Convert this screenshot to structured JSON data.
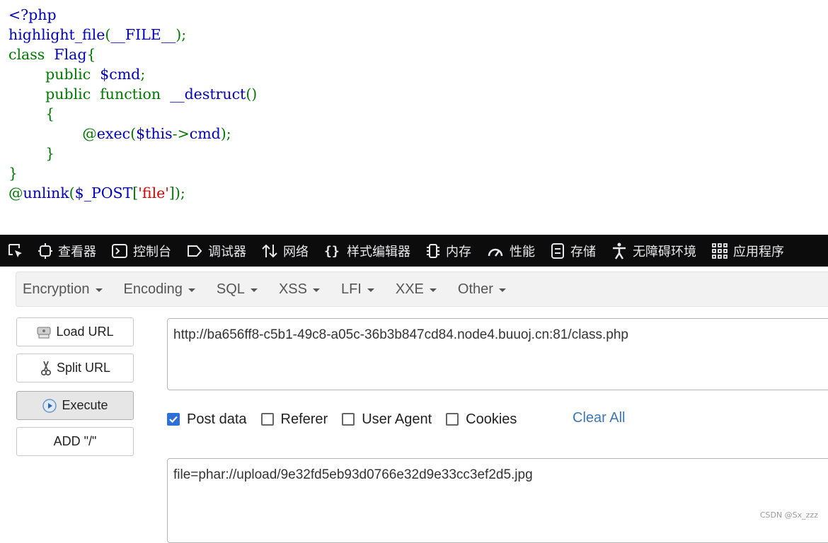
{
  "code": {
    "lines": [
      [
        {
          "t": "<?php",
          "c": "default"
        }
      ],
      [
        {
          "t": "highlight_file",
          "c": "default"
        },
        {
          "t": "(",
          "c": "keyword"
        },
        {
          "t": "__FILE__",
          "c": "default"
        },
        {
          "t": ");",
          "c": "keyword"
        }
      ],
      [
        {
          "t": "class  ",
          "c": "keyword"
        },
        {
          "t": "Flag",
          "c": "default"
        },
        {
          "t": "{",
          "c": "keyword"
        }
      ],
      [
        {
          "t": "        public  ",
          "c": "keyword"
        },
        {
          "t": "$cmd",
          "c": "default"
        },
        {
          "t": ";",
          "c": "keyword"
        }
      ],
      [
        {
          "t": "        public  function  ",
          "c": "keyword"
        },
        {
          "t": "__destruct",
          "c": "default"
        },
        {
          "t": "()",
          "c": "keyword"
        }
      ],
      [
        {
          "t": "        {",
          "c": "keyword"
        }
      ],
      [
        {
          "t": "                @",
          "c": "keyword"
        },
        {
          "t": "exec",
          "c": "default"
        },
        {
          "t": "(",
          "c": "keyword"
        },
        {
          "t": "$this",
          "c": "default"
        },
        {
          "t": "->",
          "c": "keyword"
        },
        {
          "t": "cmd",
          "c": "default"
        },
        {
          "t": ");",
          "c": "keyword"
        }
      ],
      [
        {
          "t": "        }",
          "c": "keyword"
        }
      ],
      [
        {
          "t": "}",
          "c": "keyword"
        }
      ],
      [
        {
          "t": "@",
          "c": "keyword"
        },
        {
          "t": "unlink",
          "c": "default"
        },
        {
          "t": "(",
          "c": "keyword"
        },
        {
          "t": "$_POST",
          "c": "default"
        },
        {
          "t": "[",
          "c": "keyword"
        },
        {
          "t": "'file'",
          "c": "string"
        },
        {
          "t": "]);",
          "c": "keyword"
        }
      ]
    ],
    "colors": {
      "default": "#0000bb",
      "keyword": "#007700",
      "string": "#dd0000"
    }
  },
  "devtools": {
    "tabs": [
      {
        "label": "查看器",
        "icon": "inspector-icon"
      },
      {
        "label": "控制台",
        "icon": "console-icon"
      },
      {
        "label": "调试器",
        "icon": "debugger-icon"
      },
      {
        "label": "网络",
        "icon": "network-icon"
      },
      {
        "label": "样式编辑器",
        "icon": "style-editor-icon"
      },
      {
        "label": "内存",
        "icon": "memory-icon"
      },
      {
        "label": "性能",
        "icon": "performance-icon"
      },
      {
        "label": "存储",
        "icon": "storage-icon"
      },
      {
        "label": "无障碍环境",
        "icon": "accessibility-icon"
      },
      {
        "label": "应用程序",
        "icon": "application-icon"
      }
    ],
    "background": "#0c0c0d"
  },
  "hackbar": {
    "menu": [
      "Encryption",
      "Encoding",
      "SQL",
      "XSS",
      "LFI",
      "XXE",
      "Other"
    ],
    "buttons": {
      "load_url": "Load URL",
      "split_url": "Split URL",
      "execute": "Execute",
      "add_slash": "ADD \"/\""
    },
    "url": "http://ba656ff8-c5b1-49c8-a05c-36b3b847cd84.node4.buuoj.cn:81/class.php",
    "checkboxes": {
      "post_data": {
        "label": "Post data",
        "checked": true
      },
      "referer": {
        "label": "Referer",
        "checked": false
      },
      "user_agent": {
        "label": "User Agent",
        "checked": false
      },
      "cookies": {
        "label": "Cookies",
        "checked": false
      }
    },
    "clear_all": "Clear All",
    "post_body": "file=phar://upload/9e32fd5eb93d0766e32d9e33cc3ef2d5.jpg"
  },
  "watermark": "CSDN @Sx_zzz"
}
